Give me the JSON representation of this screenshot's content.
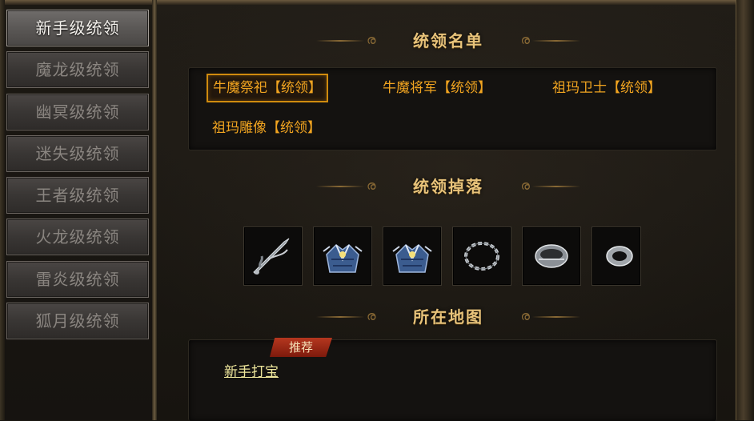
{
  "sidebar": {
    "tabs": [
      {
        "label": "新手级统领",
        "active": true
      },
      {
        "label": "魔龙级统领",
        "active": false
      },
      {
        "label": "幽冥级统领",
        "active": false
      },
      {
        "label": "迷失级统领",
        "active": false
      },
      {
        "label": "王者级统领",
        "active": false
      },
      {
        "label": "火龙级统领",
        "active": false
      },
      {
        "label": "雷炎级统领",
        "active": false
      },
      {
        "label": "狐月级统领",
        "active": false
      }
    ]
  },
  "sections": {
    "leaders_title": "统领名单",
    "drops_title": "统领掉落",
    "map_title": "所在地图"
  },
  "leaders": [
    {
      "label": "牛魔祭祀【统领】",
      "selected": true
    },
    {
      "label": "牛魔将军【统领】",
      "selected": false
    },
    {
      "label": "祖玛卫士【统领】",
      "selected": false
    },
    {
      "label": "祖玛雕像【统领】",
      "selected": false
    }
  ],
  "drops": [
    {
      "icon": "dagger-icon"
    },
    {
      "icon": "blue-armor-icon"
    },
    {
      "icon": "blue-armor-icon"
    },
    {
      "icon": "silver-chain-necklace-icon"
    },
    {
      "icon": "silver-bracelet-icon"
    },
    {
      "icon": "silver-ring-icon"
    }
  ],
  "map": {
    "badge": "推荐",
    "location": "新手打宝"
  },
  "colors": {
    "accent_gold": "#e8c37a",
    "leader_text": "#f1a420",
    "selected_border": "#d08b0e",
    "badge_red": "#b5371f",
    "link_text": "#eee69b"
  }
}
